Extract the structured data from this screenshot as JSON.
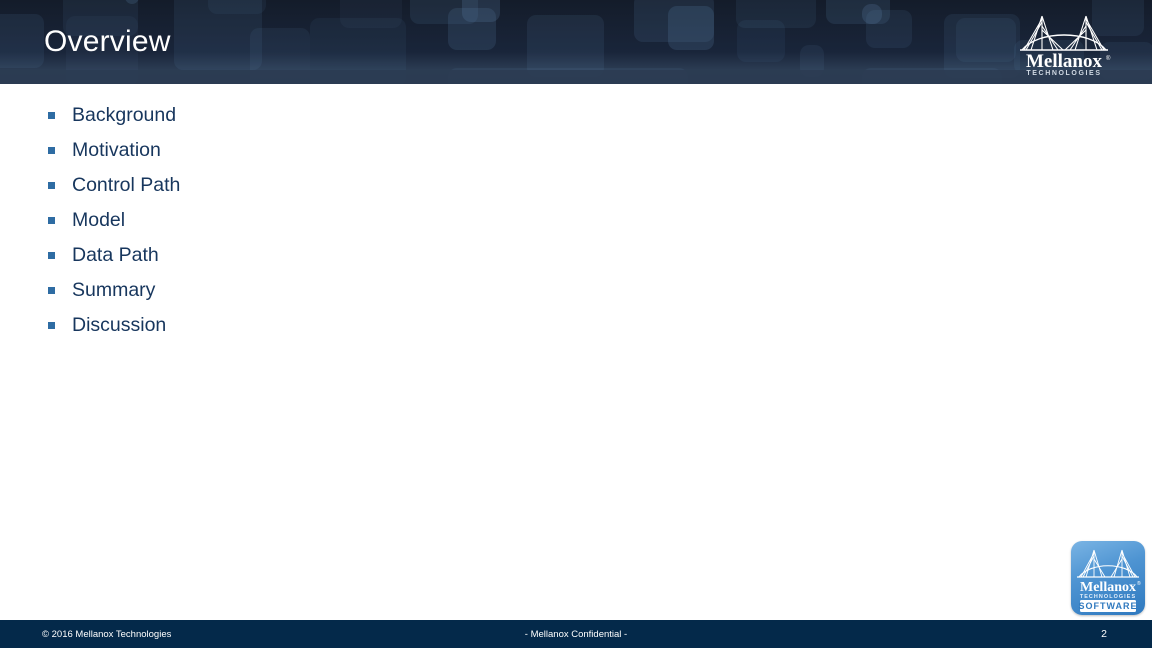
{
  "slide": {
    "title": "Overview",
    "page_number": "2"
  },
  "header": {
    "bg_color": "#161f2e",
    "strip_color": "#2b3c52",
    "title_color": "#ffffff",
    "logo": {
      "icon": "bridge-icon",
      "wordmark": "Mellanox",
      "trademark": "®",
      "subtitle": "TECHNOLOGIES"
    }
  },
  "content": {
    "bullet_color": "#2e6ca3",
    "text_color": "#17365d",
    "bullets": [
      {
        "label": "Background"
      },
      {
        "label": "Motivation"
      },
      {
        "label": "Control Path"
      },
      {
        "label": "Model"
      },
      {
        "label": "Data Path"
      },
      {
        "label": "Summary"
      },
      {
        "label": "Discussion"
      }
    ]
  },
  "software_badge": {
    "icon": "bridge-icon",
    "wordmark": "Mellanox",
    "trademark": "®",
    "subtitle": "TECHNOLOGIES",
    "label": "SOFTWARE",
    "bg_color": "#4e94d2"
  },
  "footer": {
    "bg_color": "#04294a",
    "copyright": "© 2016 Mellanox Technologies",
    "confidential": "- Mellanox Confidential -",
    "page_number": "2"
  }
}
